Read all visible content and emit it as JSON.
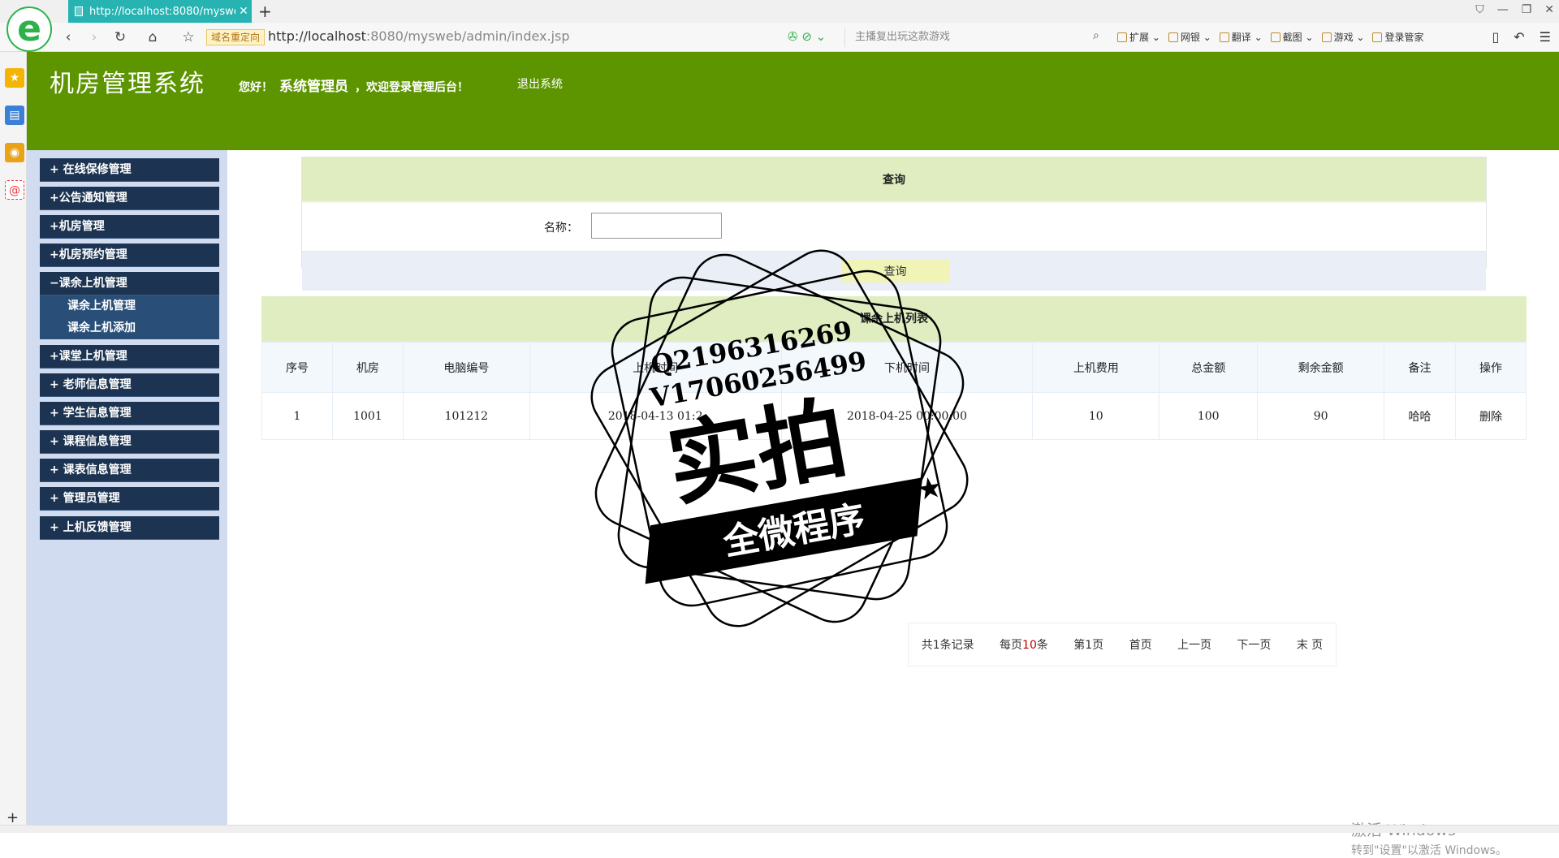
{
  "browser": {
    "tab_title": "http://localhost:8080/mysweb/",
    "url_badge": "域名重定向",
    "url_host": "http://localhost",
    "url_rest": ":8080/mysweb/admin/index.jsp",
    "search_placeholder": "主播复出玩这款游戏",
    "toolbar": [
      "扩展",
      "网银",
      "翻译",
      "截图",
      "游戏",
      "登录管家"
    ]
  },
  "header": {
    "site_title": "机房管理系统",
    "greeting_prefix": "您好！",
    "username": "系统管理员",
    "greeting_suffix": "，欢迎登录管理后台！",
    "logout": "退出系统"
  },
  "menu": {
    "items": [
      "+ 在线保修管理",
      "+公告通知管理",
      "+机房管理",
      "+机房预约管理",
      "−课余上机管理",
      "+课堂上机管理",
      "+ 老师信息管理",
      "+ 学生信息管理",
      "+ 课程信息管理",
      "+ 课表信息管理",
      "+ 管理员管理",
      "+ 上机反馈管理"
    ],
    "submenu": [
      "课余上机管理",
      "课余上机添加"
    ]
  },
  "query": {
    "title": "查询",
    "name_label": "名称：",
    "name_value": "",
    "button": "查询"
  },
  "list": {
    "title": "课余上机列表",
    "columns": [
      "序号",
      "机房",
      "电脑编号",
      "上机时间",
      "下机时间",
      "上机费用",
      "总金额",
      "剩余金额",
      "备注",
      "操作"
    ],
    "rows": [
      [
        "1",
        "1001",
        "101212",
        "2018-04-13 01:2",
        "2018-04-25 00:00:00",
        "10",
        "100",
        "90",
        "哈哈",
        "删除"
      ]
    ]
  },
  "pager": {
    "records_label": "共1条记录",
    "per_page_prefix": "每页",
    "per_page_value": "10",
    "per_page_suffix": "条",
    "page_info": "第1页",
    "first": "首页",
    "prev": "上一页",
    "next": "下一页",
    "last": "末 页"
  },
  "watermark": {
    "qq": "Q2196316269",
    "wechat": "V17060256499",
    "big_text": "实拍",
    "banner": "全微程序"
  },
  "windows_watermark": {
    "line1": "激活 Windows",
    "line2": "转到\"设置\"以激活 Windows。"
  }
}
